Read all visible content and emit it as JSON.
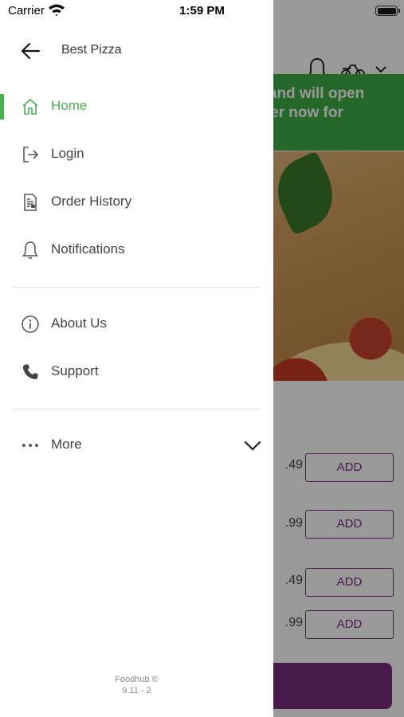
{
  "status_bar": {
    "carrier": "Carrier",
    "time": "1:59 PM"
  },
  "background": {
    "banner_lines": [
      "d and will open",
      "rder now for"
    ],
    "prices": [
      ".49",
      ".99",
      ".49",
      ".99"
    ],
    "add_label": "ADD",
    "colors": {
      "banner": "#3fae45",
      "accent": "#7b2d7f"
    }
  },
  "drawer": {
    "store_name": "Best Pizza",
    "back_icon": "arrow-left-icon",
    "items": [
      {
        "label": "Home",
        "icon": "home-icon",
        "active": true
      },
      {
        "label": "Login",
        "icon": "login-icon",
        "active": false
      },
      {
        "label": "Order History",
        "icon": "receipt-icon",
        "active": false
      },
      {
        "label": "Notifications",
        "icon": "bell-icon",
        "active": false
      }
    ],
    "secondary_items": [
      {
        "label": "About Us",
        "icon": "info-icon"
      },
      {
        "label": "Support",
        "icon": "phone-icon"
      }
    ],
    "more": {
      "label": "More",
      "icon": "more-dots-icon"
    },
    "footer": {
      "brand": "Foodhub ©",
      "version": "9.11 - 2"
    },
    "colors": {
      "active": "#4caf50",
      "text": "#444444"
    }
  }
}
